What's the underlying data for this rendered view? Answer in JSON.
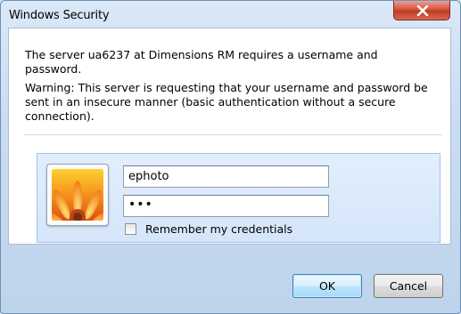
{
  "window": {
    "title": "Windows Security"
  },
  "dialog": {
    "message": "The server ua6237 at Dimensions RM requires a username and password.",
    "warning": "Warning: This server is requesting that your username and password be sent in an insecure manner (basic authentication without a secure connection)."
  },
  "credentials": {
    "username_value": "ephoto",
    "password_value": "•••",
    "remember_label": "Remember my credentials",
    "remember_checked": false,
    "avatar_icon": "user-tile-flower-icon"
  },
  "buttons": {
    "ok_label": "OK",
    "cancel_label": "Cancel"
  },
  "colors": {
    "close_button": "#c13a24",
    "credential_panel": "#d5e6fa",
    "ok_button_border": "#3c7fb1"
  }
}
